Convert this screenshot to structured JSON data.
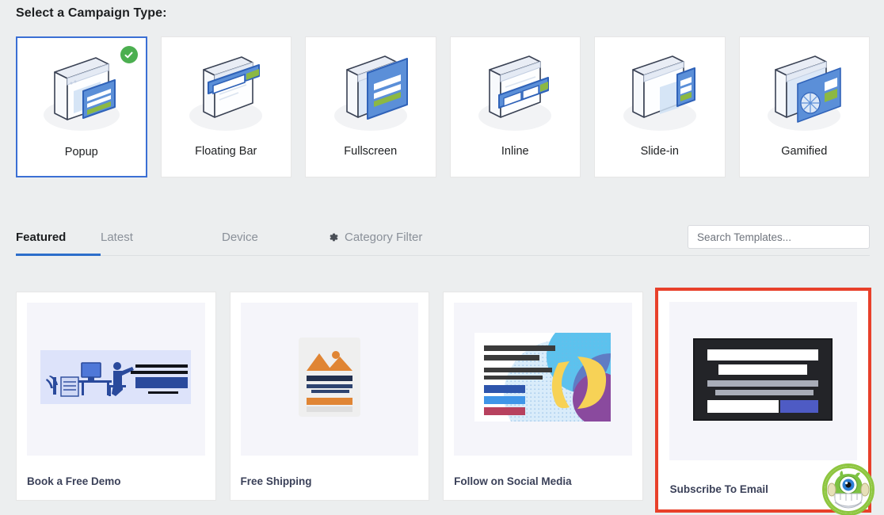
{
  "heading": "Select a Campaign Type:",
  "campaign_types": [
    {
      "label": "Popup",
      "icon": "popup-isometric-icon",
      "selected": true,
      "badge": "check-badge"
    },
    {
      "label": "Floating Bar",
      "icon": "floating-bar-isometric-icon",
      "selected": false
    },
    {
      "label": "Fullscreen",
      "icon": "fullscreen-isometric-icon",
      "selected": false
    },
    {
      "label": "Inline",
      "icon": "inline-isometric-icon",
      "selected": false
    },
    {
      "label": "Slide-in",
      "icon": "slide-in-isometric-icon",
      "selected": false
    },
    {
      "label": "Gamified",
      "icon": "gamified-isometric-icon",
      "selected": false
    }
  ],
  "tabs": [
    {
      "label": "Featured",
      "active": true,
      "icon": null
    },
    {
      "label": "Latest",
      "active": false,
      "icon": null
    },
    {
      "label": "Device",
      "active": false,
      "icon": null
    },
    {
      "label": "Category Filter",
      "active": false,
      "icon": "gear-icon"
    }
  ],
  "search": {
    "placeholder": "Search Templates...",
    "value": ""
  },
  "templates": [
    {
      "name": "Book a Free Demo",
      "thumb": "desk-person-illustration",
      "highlighted": false
    },
    {
      "name": "Free Shipping",
      "thumb": "mountain-photo-card",
      "highlighted": false
    },
    {
      "name": "Follow on Social Media",
      "thumb": "abstract-shapes-social",
      "highlighted": false
    },
    {
      "name": "Subscribe To Email",
      "thumb": "dark-optin-form",
      "highlighted": true,
      "mascot": "optinmonster-mascot-avatar"
    }
  ],
  "colors": {
    "page_bg": "#eceeef",
    "card_bg": "#ffffff",
    "selected_border": "#3b6fd4",
    "highlight_border": "#e8402a",
    "tab_active_underline": "#2c6ecb",
    "check_badge_green": "#4caf50",
    "thumb_bg": "#f5f5fa",
    "label_color": "#3b4159",
    "mascot_ring": "#8ec63f"
  }
}
